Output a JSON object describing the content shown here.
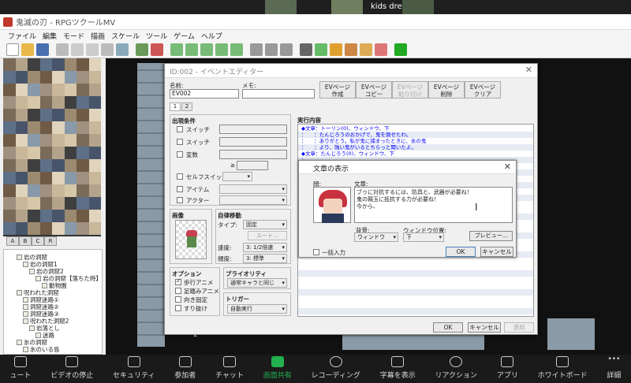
{
  "zoom": {
    "participant_name": "kids dream club"
  },
  "window": {
    "title": "鬼滅の刃 - RPGツクールMV"
  },
  "menu": [
    "ファイル",
    "編集",
    "モード",
    "描画",
    "スケール",
    "ツール",
    "ゲーム",
    "ヘルプ"
  ],
  "palette_tabs": [
    "A",
    "B",
    "C",
    "R"
  ],
  "tree": [
    "岩の洞窟",
    "岩の洞窟1",
    "岩の洞窟2",
    "岩の洞窟【落ちた時】",
    "動物園",
    "呪われた洞窟",
    "洞窟迷路①",
    "洞窟迷路②",
    "洞窟迷路③",
    "呪われた洞窟2",
    "岩落とし",
    "迷路",
    "氷の洞窟",
    "氷のいる島"
  ],
  "event_editor": {
    "title": "ID:002 - イベントエディター",
    "name_label": "名前:",
    "name_value": "EV002",
    "memo_label": "メモ:",
    "buttons": [
      {
        "label": "EVページ\n作成",
        "enabled": true
      },
      {
        "label": "EVページ\nコピー",
        "enabled": true
      },
      {
        "label": "EVページ\n貼り付け",
        "enabled": false
      },
      {
        "label": "EVページ\n削除",
        "enabled": true
      },
      {
        "label": "EVページ\nクリア",
        "enabled": true
      }
    ],
    "tabs": [
      "1",
      "2"
    ],
    "conditions_title": "出現条件",
    "conditions": [
      "スイッチ",
      "スイッチ",
      "変数",
      "セルフスイッチ",
      "アイテム",
      "アクター"
    ],
    "cond_ge": "≥",
    "image_title": "画像",
    "move_title": "自律移動",
    "move_type_label": "タイプ:",
    "move_type": "固定",
    "route_button": "ルート...",
    "speed_label": "速度:",
    "speed": "3: 1/2倍速",
    "freq_label": "頻度:",
    "freq": "3: 標準",
    "options_title": "オプション",
    "options": [
      {
        "label": "歩行アニメ",
        "checked": true
      },
      {
        "label": "足踏みアニメ",
        "checked": false
      },
      {
        "label": "向き固定",
        "checked": false
      },
      {
        "label": "すり抜け",
        "checked": false
      }
    ],
    "priority_title": "プライオリティ",
    "priority": "通常キャラと同じ",
    "trigger_title": "トリガー",
    "trigger": "自動実行",
    "contents_title": "実行内容",
    "contents": [
      "◆文章：トーリン(0)、ウィンドウ、下",
      "：　　：たんじろうのおかげで、鬼を倒せたわ。",
      "：　　：ありがとう。私が鬼に捕まったときに、氷の鬼",
      "：　　：より、強い鬼がいるとちらっと聞いたよ。",
      "◆文章：たんじろう(0)、ウィンドウ、下",
      "：",
      "：",
      "：",
      "：",
      "◆",
      "◆"
    ],
    "ok": "OK",
    "cancel": "キャンセル",
    "apply": "適用"
  },
  "text_dialog": {
    "title": "文章の表示",
    "face_label": "顔:",
    "text_label": "文章:",
    "text_lines": [
      "ブゥに対抗するには、防具と、武器が必要ね！",
      "鬼の親玉に抵抗する力が必要ね！",
      "今から、"
    ],
    "bg_label": "背景:",
    "bg_value": "ウィンドウ",
    "pos_label": "ウィンドウ位置:",
    "pos_value": "下",
    "preview": "プレビュー...",
    "batch": "一括入力",
    "ok": "OK",
    "cancel": "キャンセル"
  },
  "zoom_bar": [
    {
      "label": "ュート"
    },
    {
      "label": "ビデオの停止"
    },
    {
      "label": "セキュリティ"
    },
    {
      "label": "参加者",
      "badge": "2"
    },
    {
      "label": "チャット"
    },
    {
      "label": "画面共有"
    },
    {
      "label": "レコーディング"
    },
    {
      "label": "字幕を表示"
    },
    {
      "label": "リアクション"
    },
    {
      "label": "アプリ"
    },
    {
      "label": "ホワイトボード"
    },
    {
      "label": "詳細"
    }
  ]
}
